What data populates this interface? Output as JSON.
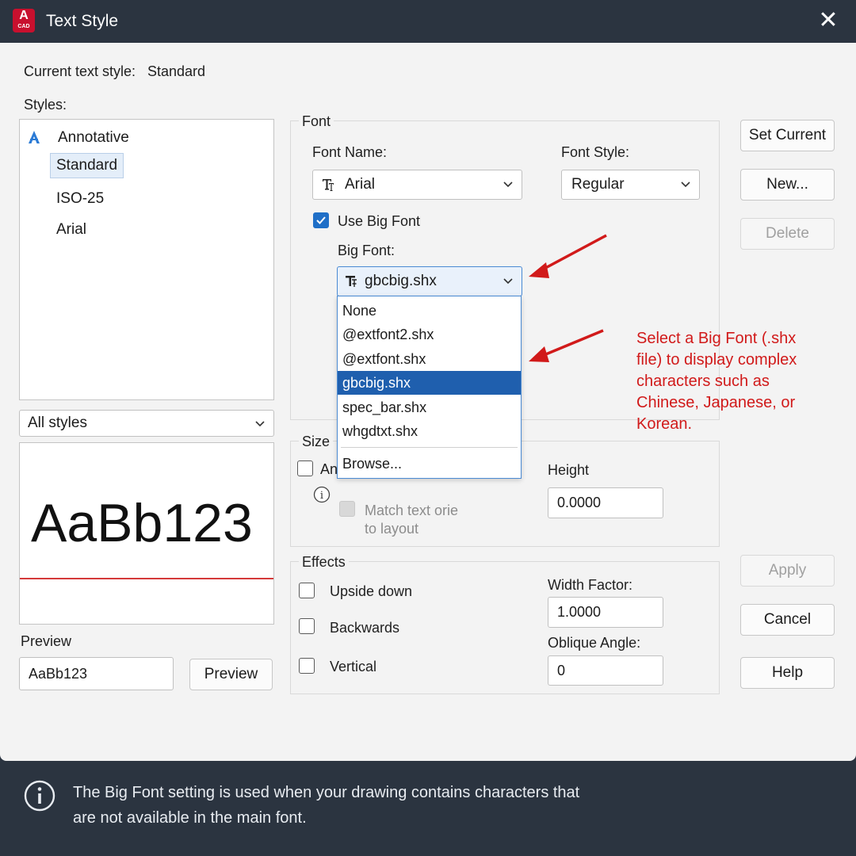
{
  "titlebar": {
    "title": "Text Style",
    "logo_letter": "A",
    "logo_sub": "CAD",
    "close_icon": "close-icon"
  },
  "current_style": {
    "label": "Current text style:",
    "value": "Standard"
  },
  "styles": {
    "label": "Styles:",
    "items": [
      {
        "label": "Annotative",
        "annotative": true
      },
      {
        "label": "Standard",
        "selected": true
      },
      {
        "label": "ISO-25"
      },
      {
        "label": "Arial"
      }
    ],
    "filter_value": "All styles"
  },
  "preview": {
    "sample": "AaBb123",
    "label": "Preview",
    "input_value": "AaBb123",
    "button_label": "Preview"
  },
  "font": {
    "group_title": "Font",
    "font_name_label": "Font Name:",
    "font_name_value": "Arial",
    "font_style_label": "Font Style:",
    "font_style_value": "Regular",
    "use_big_font_label": "Use Big Font",
    "use_big_font_checked": true,
    "big_font_label": "Big Font:",
    "big_font_value": "gbcbig.shx",
    "big_font_options": [
      "None",
      "@extfont2.shx",
      "@extfont.shx",
      "gbcbig.shx",
      "spec_bar.shx",
      "whgdtxt.shx"
    ],
    "big_font_selected": "gbcbig.shx",
    "browse_label": "Browse..."
  },
  "size": {
    "group_title": "Size",
    "annotative_label": "An",
    "match_label_1": "Match text orie",
    "match_label_2": "to layout",
    "height_label": "Height",
    "height_value": "0.0000"
  },
  "effects": {
    "group_title": "Effects",
    "upside_down": "Upside down",
    "backwards": "Backwards",
    "vertical": "Vertical",
    "width_factor_label": "Width Factor:",
    "width_factor_value": "1.0000",
    "oblique_label": "Oblique Angle:",
    "oblique_value": "0"
  },
  "buttons": {
    "set_current": "Set Current",
    "new": "New...",
    "delete": "Delete",
    "apply": "Apply",
    "cancel": "Cancel",
    "help": "Help"
  },
  "annotation_text": "Select a Big Font (.shx file) to display complex characters such as Chinese, Japanese, or Korean.",
  "footer": {
    "line1": "The Big Font setting is used when your drawing contains characters that",
    "line2": "are not available in the main font."
  },
  "colors": {
    "titlebar": "#2b3440",
    "accent": "#1f6fc7",
    "selection": "#1f5fae",
    "annotation_red": "#d11a1a"
  }
}
